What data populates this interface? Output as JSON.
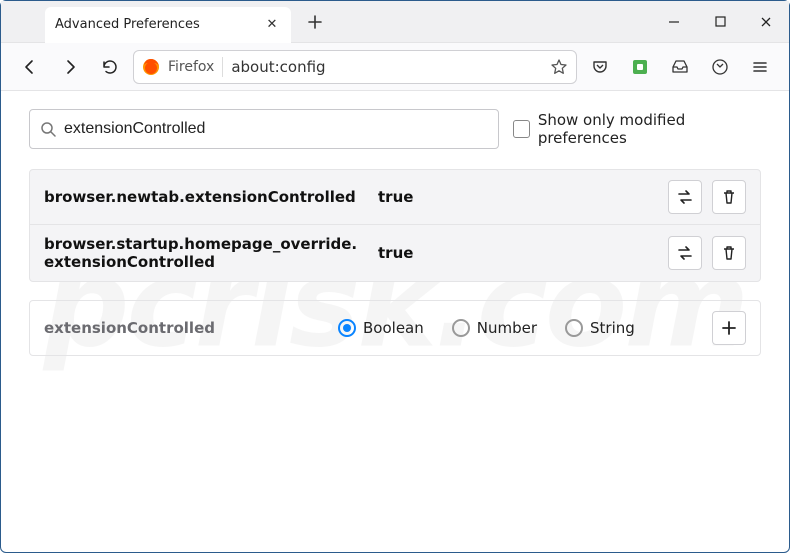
{
  "window": {
    "tab_title": "Advanced Preferences"
  },
  "urlbar": {
    "identity_label": "Firefox",
    "url": "about:config"
  },
  "search": {
    "value": "extensionControlled",
    "modified_label": "Show only modified preferences"
  },
  "prefs": [
    {
      "name": "browser.newtab.extensionControlled",
      "value": "true"
    },
    {
      "name": "browser.startup.homepage_override.extensionControlled",
      "value": "true"
    }
  ],
  "add": {
    "name": "extensionControlled",
    "types": {
      "boolean": "Boolean",
      "number": "Number",
      "string": "String"
    },
    "selected": "boolean"
  },
  "watermark": "pcrisk.com"
}
